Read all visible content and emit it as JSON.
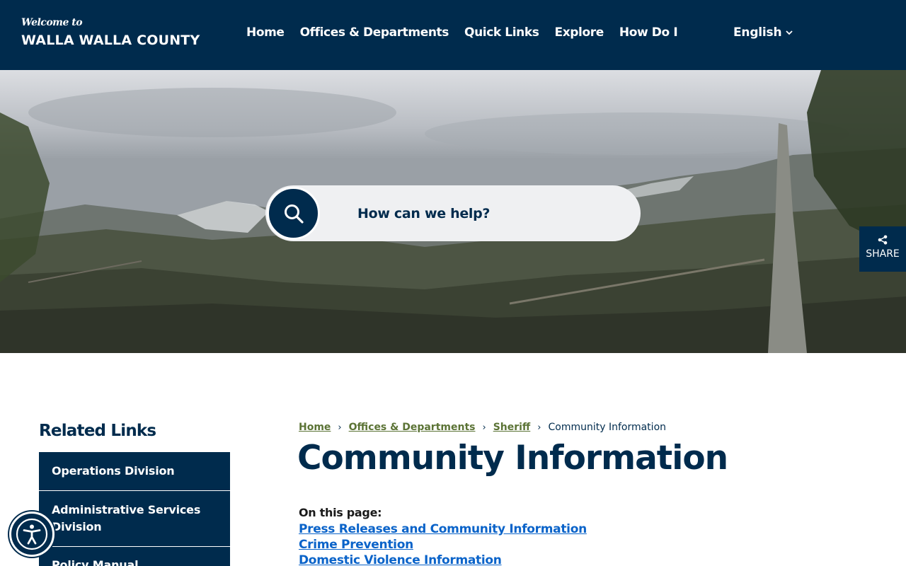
{
  "header": {
    "welcome": "Welcome to",
    "county": "WALLA WALLA COUNTY",
    "nav": [
      "Home",
      "Offices & Departments",
      "Quick Links",
      "Explore",
      "How Do I"
    ],
    "language": "English",
    "colors": {
      "navy": "#002b4d"
    }
  },
  "hero": {
    "search_placeholder": "How can we help?",
    "search_icon": "search-icon",
    "share_label": "SHARE",
    "share_icon": "share-icon"
  },
  "sidebar": {
    "title": "Related Links",
    "items": [
      "Operations Division",
      "Administrative Services Division",
      "Policy Manual"
    ]
  },
  "main": {
    "breadcrumb": {
      "links": [
        "Home",
        "Offices & Departments",
        "Sheriff"
      ],
      "current": "Community Information"
    },
    "title": "Community Information",
    "on_page_label": "On this page:",
    "toc": [
      "Press Releases and Community Information",
      "Crime Prevention",
      "Domestic Violence Information"
    ]
  },
  "accessibility": {
    "icon": "accessibility-icon"
  }
}
